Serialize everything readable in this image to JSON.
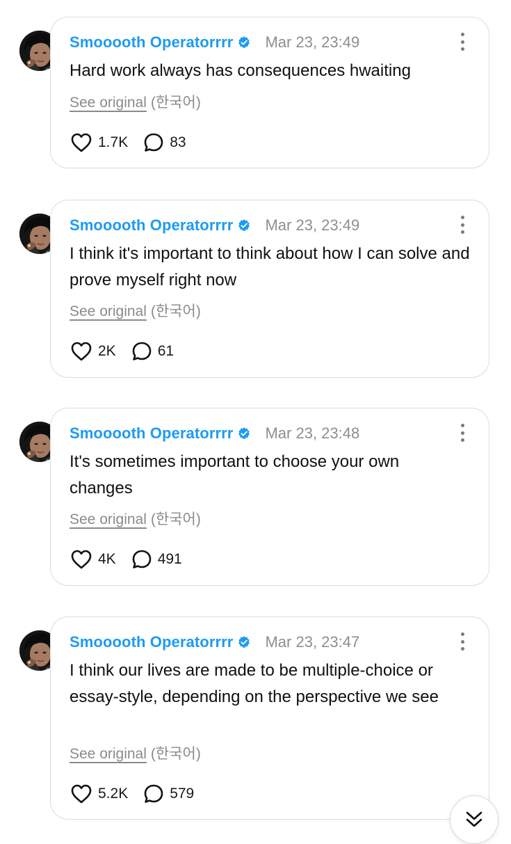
{
  "posts": [
    {
      "username": "Smooooth Operatorrrr",
      "timestamp": "Mar 23, 23:49",
      "text": "Hard work always has consequences hwaiting",
      "see_original": "See original",
      "language": "(한국어)",
      "likes": "1.7K",
      "replies": "83"
    },
    {
      "username": "Smooooth Operatorrrr",
      "timestamp": "Mar 23, 23:49",
      "text": "I think it's important to think about how I can solve and prove myself right now",
      "see_original": "See original",
      "language": "(한국어)",
      "likes": "2K",
      "replies": "61"
    },
    {
      "username": "Smooooth Operatorrrr",
      "timestamp": "Mar 23, 23:48",
      "text": "It's sometimes important to choose your own changes",
      "see_original": "See original",
      "language": "(한국어)",
      "likes": "4K",
      "replies": "491"
    },
    {
      "username": "Smooooth Operatorrrr",
      "timestamp": "Mar 23, 23:47",
      "text": "I think our lives are made to be multiple-choice or essay-style, depending on the perspective we see",
      "see_original": "See original",
      "language": "(한국어)",
      "likes": "5.2K",
      "replies": "579"
    }
  ],
  "icons": {
    "like": "heart-icon",
    "reply": "speech-bubble-icon",
    "more": "more-vertical-icon",
    "verified": "verified-badge-icon",
    "scroll": "double-chevron-down-icon"
  },
  "colors": {
    "username": "#1d9bf0",
    "verified_badge": "#1d9bf0",
    "timestamp": "#8e8e8e",
    "card_border": "#dcdcdc"
  }
}
